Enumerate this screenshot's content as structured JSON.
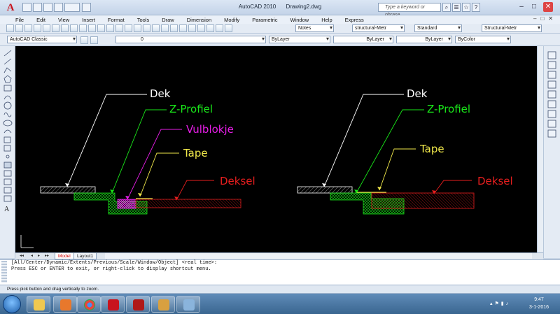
{
  "window": {
    "app_name": "AutoCAD 2010",
    "document": "Drawing2.dwg",
    "search_placeholder": "Type a keyword or phrase"
  },
  "menu": [
    "File",
    "Edit",
    "View",
    "Insert",
    "Format",
    "Tools",
    "Draw",
    "Dimension",
    "Modify",
    "Parametric",
    "Window",
    "Help",
    "Express"
  ],
  "toolbar": {
    "workspace": "AutoCAD Classic",
    "layer": "0",
    "text_style": "Notes",
    "dim_style": "structural-Metr",
    "table_style": "Standard",
    "mleader_style": "Structural-Metr",
    "color": "ByLayer",
    "linetype": "ByLayer",
    "lineweight": "ByLayer",
    "plot_style": "ByColor"
  },
  "drawing": {
    "left_labels": {
      "dek": "Dek",
      "z_profiel": "Z-Profiel",
      "vulblokje": "Vulblokje",
      "tape": "Tape",
      "deksel": "Deksel"
    },
    "right_labels": {
      "dek": "Dek",
      "z_profiel": "Z-Profiel",
      "tape": "Tape",
      "deksel": "Deksel"
    },
    "colors": {
      "dek": "#ffffff",
      "z_profiel": "#19e619",
      "vulblokje": "#e61ee6",
      "tape": "#f0e84a",
      "deksel": "#e61e1e"
    }
  },
  "tabs": {
    "model": "Model",
    "layout1": "Layout1"
  },
  "command_line": {
    "line1": "[All/Center/Dynamic/Extents/Previous/Scale/Window/Object] <real time>:",
    "line2": "Press ESC or ENTER to exit, or right-click to display shortcut menu."
  },
  "status_bar": "Press pick button and drag vertically to zoom.",
  "clock": {
    "time": "9:47",
    "date": "3-1-2016"
  }
}
